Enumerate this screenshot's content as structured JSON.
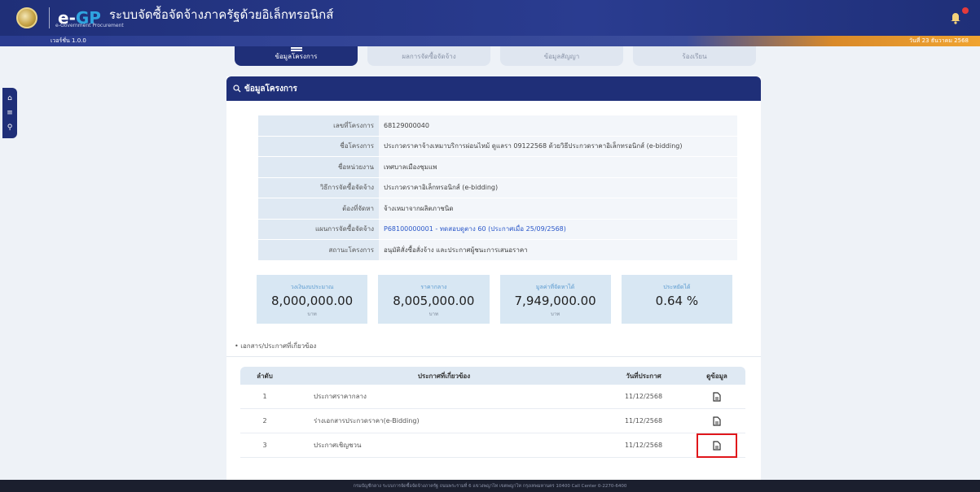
{
  "header": {
    "logo_e": "e-",
    "logo_gp": "GP",
    "logo_subtitle": "e-Government Procurement",
    "app_title": "ระบบจัดซื้อจัดจ้างภาครัฐด้วยอิเล็กทรอนิกส์",
    "version": "เวอร์ชั่น 1.0.0",
    "datetime": "วันที่ 23 ธันวาคม 2568",
    "accent_color": "#1f2f78"
  },
  "tabs": [
    {
      "label": "ข้อมูลโครงการ",
      "active": true
    },
    {
      "label": "ผลการจัดซื้อจัดจ้าง",
      "active": false
    },
    {
      "label": "ข้อมูลสัญญา",
      "active": false
    },
    {
      "label": "ร้องเรียน",
      "active": false
    }
  ],
  "panel": {
    "title": "ข้อมูลโครงการ"
  },
  "project_info": [
    {
      "label": "เลขที่โครงการ",
      "value": "68129000040"
    },
    {
      "label": "ชื่อโครงการ",
      "value": "ประกวดราคาจ้างเหมาบริการผ่อนไหม้ ดูแลรา 09122568 ด้วยวิธีประกวดราคาอิเล็กทรอนิกส์ (e-bidding)"
    },
    {
      "label": "ชื่อหน่วยงาน",
      "value": "เทศบาลเมืองชุมแพ"
    },
    {
      "label": "วิธีการจัดซื้อจัดจ้าง",
      "value": "ประกวดราคาอิเล็กทรอนิกส์ (e-bidding)"
    },
    {
      "label": "ต้องที่จัดหา",
      "value": "จ้างเหมาจากผลิตภาชนิด"
    },
    {
      "label": "แผนการจัดซื้อจัดจ้าง",
      "value": "P68100000001 - ทดสอบดูตาง 60 (ประกาศเมื่อ 25/09/2568)",
      "link": true
    },
    {
      "label": "สถานะโครงการ",
      "value": "อนุมัติสั่งซื้อสั่งจ้าง และประกาศผู้ชนะการเสนอราคา"
    }
  ],
  "summary_cards": [
    {
      "label": "วงเงินงบประมาณ",
      "value": "8,000,000.00",
      "unit": "บาท"
    },
    {
      "label": "ราคากลาง",
      "value": "8,005,000.00",
      "unit": "บาท"
    },
    {
      "label": "มูลค่าที่จัดหาได้",
      "value": "7,949,000.00",
      "unit": "บาท"
    },
    {
      "label": "ประหยัดได้",
      "value": "0.64 %",
      "unit": ""
    }
  ],
  "documents": {
    "section_title": "เอกสาร/ประกาศที่เกี่ยวข้อง",
    "columns": [
      "ลำดับ",
      "ประกาศที่เกี่ยวข้อง",
      "วันที่ประกาศ",
      "ดูข้อมูล"
    ],
    "rows": [
      {
        "no": "1",
        "name": "ประกาศราคากลาง",
        "date": "11/12/2568",
        "highlight": false
      },
      {
        "no": "2",
        "name": "ร่างเอกสารประกวดราคา(e-Bidding)",
        "date": "11/12/2568",
        "highlight": false
      },
      {
        "no": "3",
        "name": "ประกาศเชิญชวน",
        "date": "11/12/2568",
        "highlight": true
      }
    ]
  },
  "footer": {
    "text": "กรมบัญชีกลาง ระบบการจัดซื้อจัดจ้างภาครัฐ ถนนพระรามที่ 6 แขวงพญาไท เขตพญาไท กรุงเทพมหานคร 10400 Call Center 0-2270-6400"
  }
}
